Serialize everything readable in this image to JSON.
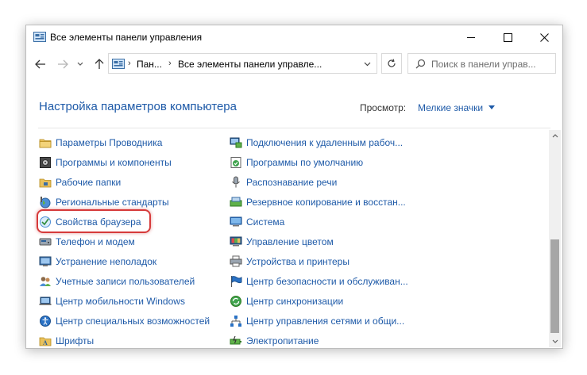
{
  "window": {
    "title": "Все элементы панели управления"
  },
  "address_bar": {
    "crumbs": [
      "Пан...",
      "Все элементы панели управле..."
    ]
  },
  "search": {
    "placeholder": "Поиск в панели управ..."
  },
  "header": {
    "title": "Настройка параметров компьютера",
    "view_label": "Просмотр:",
    "view_value": "Мелкие значки"
  },
  "items_left": [
    {
      "label": "Параметры Проводника",
      "icon": "folder-options-icon"
    },
    {
      "label": "Программы и компоненты",
      "icon": "programs-icon"
    },
    {
      "label": "Рабочие папки",
      "icon": "work-folders-icon"
    },
    {
      "label": "Региональные стандарты",
      "icon": "region-icon"
    },
    {
      "label": "Свойства браузера",
      "icon": "internet-options-icon"
    },
    {
      "label": "Телефон и модем",
      "icon": "phone-modem-icon"
    },
    {
      "label": "Устранение неполадок",
      "icon": "troubleshooting-icon"
    },
    {
      "label": "Учетные записи пользователей",
      "icon": "user-accounts-icon"
    },
    {
      "label": "Центр мобильности Windows",
      "icon": "mobility-center-icon"
    },
    {
      "label": "Центр специальных возможностей",
      "icon": "ease-of-access-icon"
    },
    {
      "label": "Шрифты",
      "icon": "fonts-icon"
    }
  ],
  "items_right": [
    {
      "label": "Подключения к удаленным рабоч...",
      "icon": "remote-desktop-icon"
    },
    {
      "label": "Программы по умолчанию",
      "icon": "default-programs-icon"
    },
    {
      "label": "Распознавание речи",
      "icon": "speech-recognition-icon"
    },
    {
      "label": "Резервное копирование и восстан...",
      "icon": "backup-icon"
    },
    {
      "label": "Система",
      "icon": "system-icon"
    },
    {
      "label": "Управление цветом",
      "icon": "color-management-icon"
    },
    {
      "label": "Устройства и принтеры",
      "icon": "devices-printers-icon"
    },
    {
      "label": "Центр безопасности и обслуживан...",
      "icon": "security-flag-icon"
    },
    {
      "label": "Центр синхронизации",
      "icon": "sync-center-icon"
    },
    {
      "label": "Центр управления сетями и общи...",
      "icon": "network-center-icon"
    },
    {
      "label": "Электропитание",
      "icon": "power-options-icon"
    }
  ],
  "colors": {
    "link": "#1e5aa8",
    "highlight": "#d63a3a"
  }
}
